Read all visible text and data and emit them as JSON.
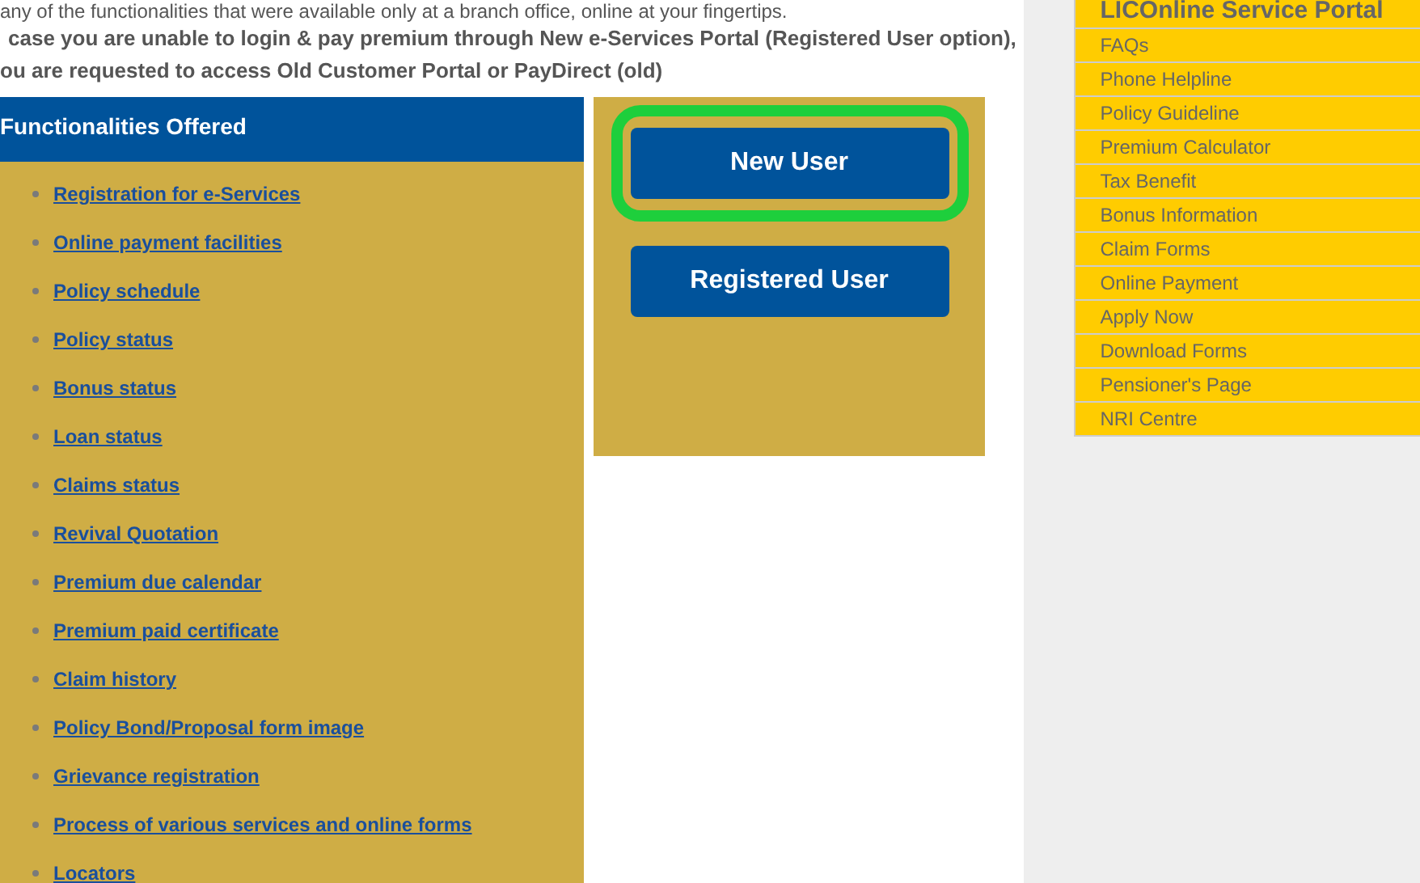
{
  "intro": [
    "any of the functionalities that were available only at a branch office, online at your fingertips.",
    "case you are unable to login & pay premium through New e-Services Portal (Registered User option),",
    "ou are requested to access Old Customer Portal or PayDirect (old)"
  ],
  "functionalities": {
    "title": "Functionalities Offered",
    "items": [
      {
        "label": "Registration for e-Services"
      },
      {
        "label": "Online payment facilities"
      },
      {
        "label": "Policy schedule"
      },
      {
        "label": "Policy status"
      },
      {
        "label": "Bonus status"
      },
      {
        "label": "Loan status"
      },
      {
        "label": "Claims status"
      },
      {
        "label": "Revival Quotation"
      },
      {
        "label": "Premium due calendar"
      },
      {
        "label": "Premium paid certificate"
      },
      {
        "label": "Claim history"
      },
      {
        "label": "Policy Bond/Proposal form image"
      },
      {
        "label": "Grievance registration"
      },
      {
        "label": "Process of various services and online forms"
      },
      {
        "label": "Locators"
      }
    ]
  },
  "login_buttons": [
    {
      "label": "New User",
      "highlighted": true
    },
    {
      "label": "Registered User",
      "highlighted": false
    }
  ],
  "sidebar": {
    "title": "LICOnline Service Portal",
    "items": [
      "FAQs",
      "Phone Helpline",
      "Policy Guideline",
      "Premium Calculator",
      "Tax Benefit",
      "Bonus Information",
      "Claim Forms",
      "Online Payment",
      "Apply Now",
      "Download Forms",
      "Pensioner's Page",
      "NRI Centre"
    ]
  }
}
